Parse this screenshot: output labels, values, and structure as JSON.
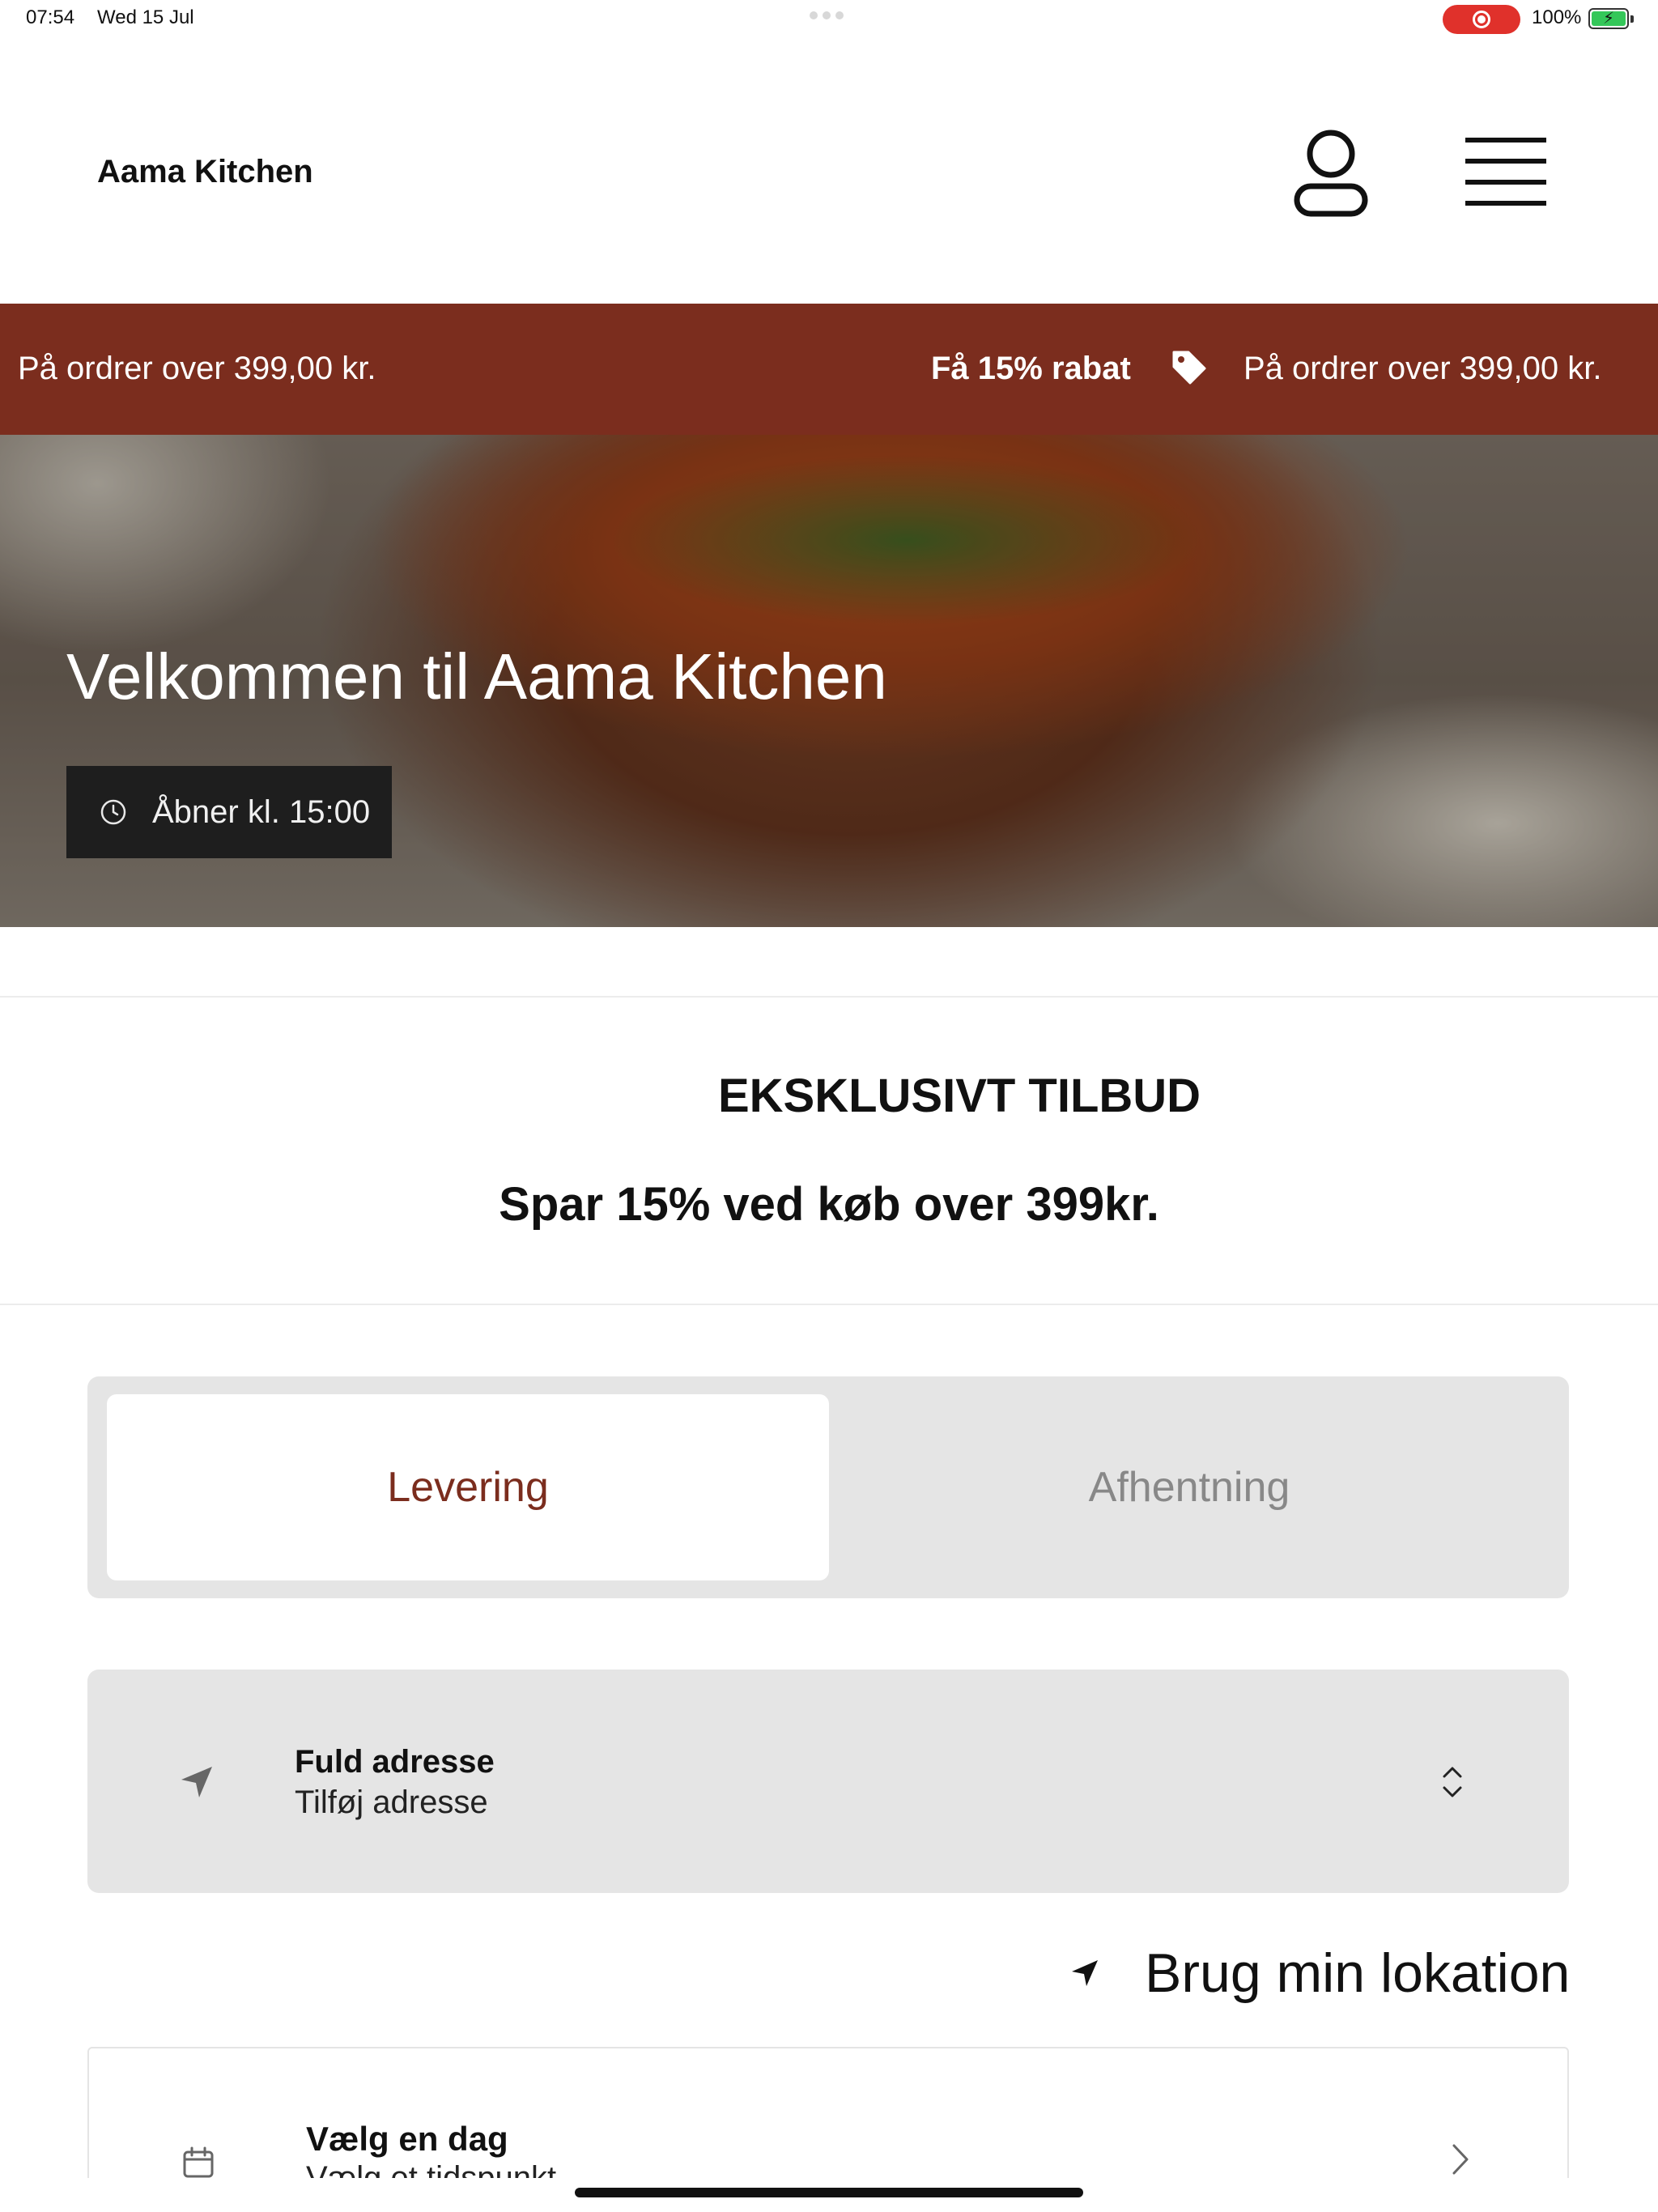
{
  "status_bar": {
    "time": "07:54",
    "date": "Wed 15 Jul",
    "battery": "100%",
    "recording_color": "#e0312b",
    "battery_color": "#34c759"
  },
  "header": {
    "brand": "Aama Kitchen",
    "icons": [
      "profile-icon",
      "menu-icon"
    ]
  },
  "promo_banner": {
    "background": "#7b2d1e",
    "text_left": "På ordrer over 399,00 kr.",
    "highlight": "Få 15% rabat",
    "text_right": "På ordrer over 399,00 kr.",
    "icon": "tag-icon"
  },
  "hero": {
    "title": "Velkommen til Aama Kitchen",
    "hours": "Åbner kl. 15:00",
    "icon": "clock-icon"
  },
  "offer": {
    "title": "EKSKLUSIVT TILBUD",
    "subtitle": "Spar 15% ved køb over 399kr."
  },
  "order_mode": {
    "options": [
      "Levering",
      "Afhentning"
    ],
    "selected": "Levering",
    "accent": "#7b2d1e"
  },
  "address": {
    "label": "Fuld adresse",
    "value": "Tilføj adresse",
    "icon": "location-arrow-icon"
  },
  "use_location": {
    "label": "Brug min lokation"
  },
  "schedule": {
    "label": "Vælg en dag",
    "value": "Vælg et tidspunkt",
    "icon": "calendar-icon"
  }
}
